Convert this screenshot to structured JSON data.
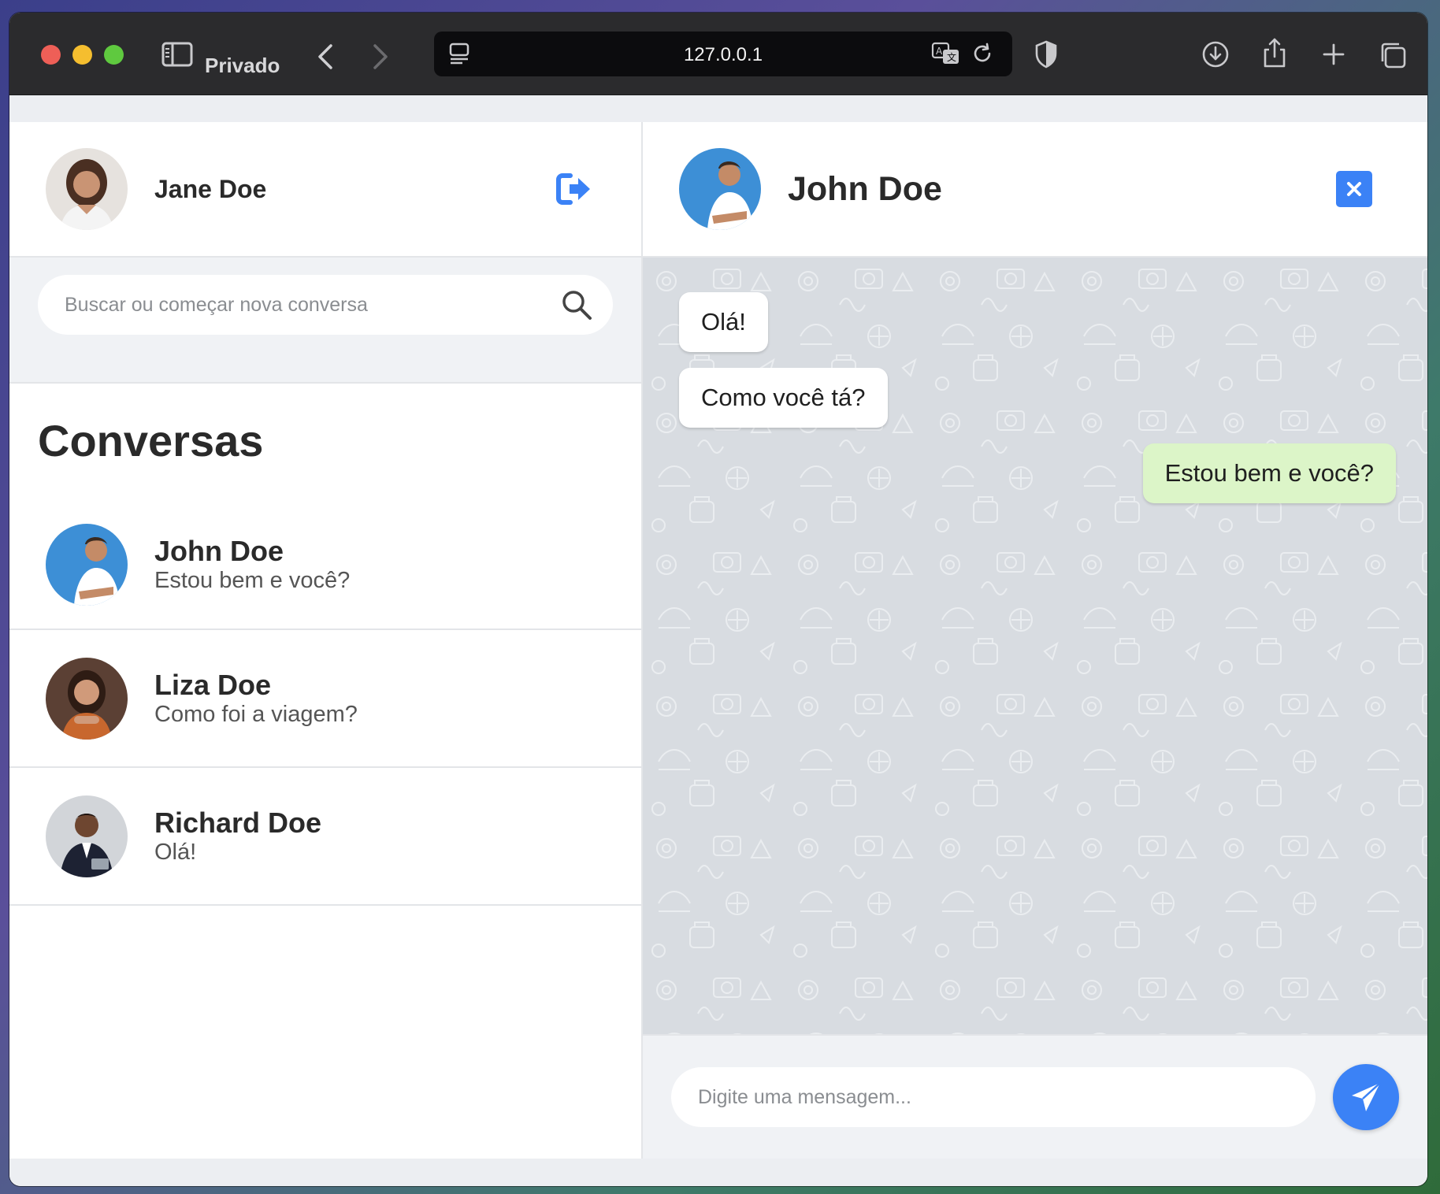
{
  "browser": {
    "private_label": "Privado",
    "url": "127.0.0.1"
  },
  "profile": {
    "name": "Jane Doe",
    "avatar_icon": "woman-avatar"
  },
  "search": {
    "placeholder": "Buscar ou começar nova conversa"
  },
  "conversations": {
    "title": "Conversas",
    "items": [
      {
        "name": "John Doe",
        "last_message": "Estou bem e você?",
        "avatar_color": "#3d8fd6"
      },
      {
        "name": "Liza Doe",
        "last_message": "Como foi a viagem?",
        "avatar_color": "#6b4a3a"
      },
      {
        "name": "Richard Doe",
        "last_message": "Olá!",
        "avatar_color": "#cfd2d6"
      }
    ]
  },
  "chat": {
    "contact_name": "John Doe",
    "messages": [
      {
        "text": "Olá!",
        "direction": "in"
      },
      {
        "text": "Como você tá?",
        "direction": "in"
      },
      {
        "text": "Estou bem e você?",
        "direction": "out"
      }
    ],
    "composer_placeholder": "Digite uma mensagem..."
  },
  "colors": {
    "accent": "#3b82f6",
    "incoming_bubble": "#ffffff",
    "outgoing_bubble": "#dcf5c8",
    "chat_background": "#d8dce1"
  }
}
